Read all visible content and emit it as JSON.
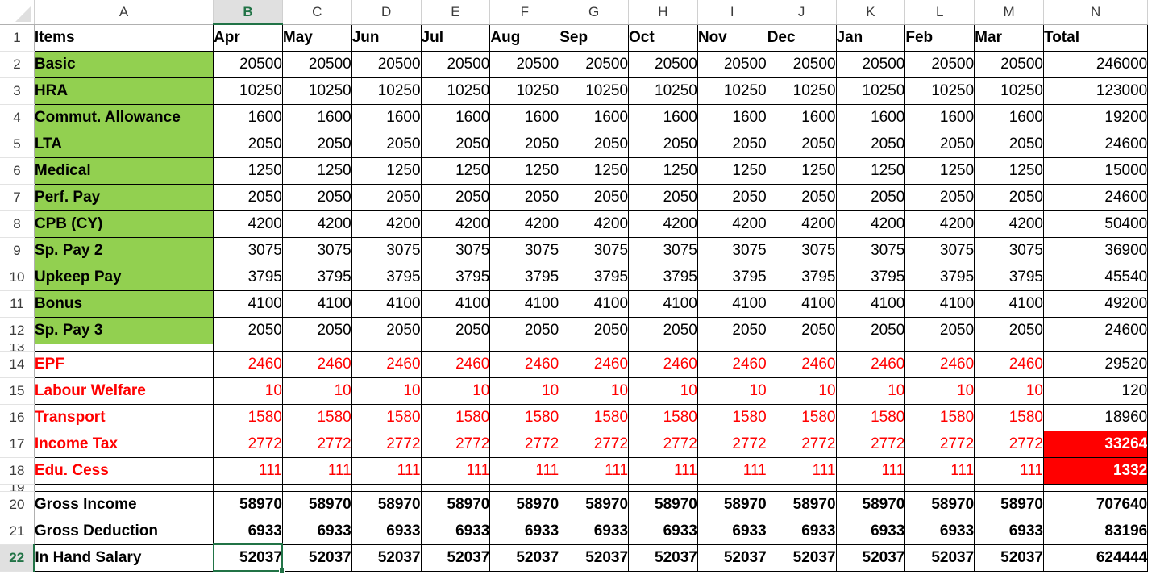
{
  "app": {
    "type": "spreadsheet",
    "select_all_label": "",
    "active_cell": "B22",
    "selected_column": "B",
    "selected_row": "22"
  },
  "colors": {
    "earnings_fill": "#92D050",
    "deduction_text": "#FF0000",
    "highlight_fill": "#FF0000",
    "highlight_text": "#FFFFFF",
    "selection_accent": "#217346"
  },
  "columns": [
    {
      "letter": "A",
      "selected": false
    },
    {
      "letter": "B",
      "selected": true
    },
    {
      "letter": "C",
      "selected": false
    },
    {
      "letter": "D",
      "selected": false
    },
    {
      "letter": "E",
      "selected": false
    },
    {
      "letter": "F",
      "selected": false
    },
    {
      "letter": "G",
      "selected": false
    },
    {
      "letter": "H",
      "selected": false
    },
    {
      "letter": "I",
      "selected": false
    },
    {
      "letter": "J",
      "selected": false
    },
    {
      "letter": "K",
      "selected": false
    },
    {
      "letter": "L",
      "selected": false
    },
    {
      "letter": "M",
      "selected": false
    },
    {
      "letter": "N",
      "selected": false
    }
  ],
  "header_row": {
    "row_number": "1",
    "cells": [
      "Items",
      "Apr",
      "May",
      "Jun",
      "Jul",
      "Aug",
      "Sep",
      "Oct",
      "Nov",
      "Dec",
      "Jan",
      "Feb",
      "Mar",
      "Total"
    ]
  },
  "rows": [
    {
      "row_number": "2",
      "kind": "earning",
      "label": "Basic",
      "values": [
        "20500",
        "20500",
        "20500",
        "20500",
        "20500",
        "20500",
        "20500",
        "20500",
        "20500",
        "20500",
        "20500",
        "20500"
      ],
      "total": "246000"
    },
    {
      "row_number": "3",
      "kind": "earning",
      "label": "HRA",
      "values": [
        "10250",
        "10250",
        "10250",
        "10250",
        "10250",
        "10250",
        "10250",
        "10250",
        "10250",
        "10250",
        "10250",
        "10250"
      ],
      "total": "123000"
    },
    {
      "row_number": "4",
      "kind": "earning",
      "label": "Commut. Allowance",
      "values": [
        "1600",
        "1600",
        "1600",
        "1600",
        "1600",
        "1600",
        "1600",
        "1600",
        "1600",
        "1600",
        "1600",
        "1600"
      ],
      "total": "19200"
    },
    {
      "row_number": "5",
      "kind": "earning",
      "label": "LTA",
      "values": [
        "2050",
        "2050",
        "2050",
        "2050",
        "2050",
        "2050",
        "2050",
        "2050",
        "2050",
        "2050",
        "2050",
        "2050"
      ],
      "total": "24600"
    },
    {
      "row_number": "6",
      "kind": "earning",
      "label": "Medical",
      "values": [
        "1250",
        "1250",
        "1250",
        "1250",
        "1250",
        "1250",
        "1250",
        "1250",
        "1250",
        "1250",
        "1250",
        "1250"
      ],
      "total": "15000"
    },
    {
      "row_number": "7",
      "kind": "earning",
      "label": "Perf. Pay",
      "values": [
        "2050",
        "2050",
        "2050",
        "2050",
        "2050",
        "2050",
        "2050",
        "2050",
        "2050",
        "2050",
        "2050",
        "2050"
      ],
      "total": "24600"
    },
    {
      "row_number": "8",
      "kind": "earning",
      "label": "CPB (CY)",
      "values": [
        "4200",
        "4200",
        "4200",
        "4200",
        "4200",
        "4200",
        "4200",
        "4200",
        "4200",
        "4200",
        "4200",
        "4200"
      ],
      "total": "50400"
    },
    {
      "row_number": "9",
      "kind": "earning",
      "label": "Sp. Pay 2",
      "values": [
        "3075",
        "3075",
        "3075",
        "3075",
        "3075",
        "3075",
        "3075",
        "3075",
        "3075",
        "3075",
        "3075",
        "3075"
      ],
      "total": "36900"
    },
    {
      "row_number": "10",
      "kind": "earning",
      "label": "Upkeep Pay",
      "values": [
        "3795",
        "3795",
        "3795",
        "3795",
        "3795",
        "3795",
        "3795",
        "3795",
        "3795",
        "3795",
        "3795",
        "3795"
      ],
      "total": "45540"
    },
    {
      "row_number": "11",
      "kind": "earning",
      "label": "Bonus",
      "values": [
        "4100",
        "4100",
        "4100",
        "4100",
        "4100",
        "4100",
        "4100",
        "4100",
        "4100",
        "4100",
        "4100",
        "4100"
      ],
      "total": "49200"
    },
    {
      "row_number": "12",
      "kind": "earning",
      "label": "Sp. Pay 3",
      "values": [
        "2050",
        "2050",
        "2050",
        "2050",
        "2050",
        "2050",
        "2050",
        "2050",
        "2050",
        "2050",
        "2050",
        "2050"
      ],
      "total": "24600"
    },
    {
      "row_number": "13",
      "kind": "spacer",
      "label": "",
      "values": [
        "",
        "",
        "",
        "",
        "",
        "",
        "",
        "",
        "",
        "",
        "",
        ""
      ],
      "total": ""
    },
    {
      "row_number": "14",
      "kind": "deduction",
      "label": "EPF",
      "values": [
        "2460",
        "2460",
        "2460",
        "2460",
        "2460",
        "2460",
        "2460",
        "2460",
        "2460",
        "2460",
        "2460",
        "2460"
      ],
      "total": "29520"
    },
    {
      "row_number": "15",
      "kind": "deduction",
      "label": "Labour Welfare",
      "values": [
        "10",
        "10",
        "10",
        "10",
        "10",
        "10",
        "10",
        "10",
        "10",
        "10",
        "10",
        "10"
      ],
      "total": "120"
    },
    {
      "row_number": "16",
      "kind": "deduction",
      "label": "Transport",
      "values": [
        "1580",
        "1580",
        "1580",
        "1580",
        "1580",
        "1580",
        "1580",
        "1580",
        "1580",
        "1580",
        "1580",
        "1580"
      ],
      "total": "18960"
    },
    {
      "row_number": "17",
      "kind": "deduction",
      "label": "Income Tax",
      "values": [
        "2772",
        "2772",
        "2772",
        "2772",
        "2772",
        "2772",
        "2772",
        "2772",
        "2772",
        "2772",
        "2772",
        "2772"
      ],
      "total": "33264",
      "total_highlight": true
    },
    {
      "row_number": "18",
      "kind": "deduction",
      "label": "Edu. Cess",
      "values": [
        "111",
        "111",
        "111",
        "111",
        "111",
        "111",
        "111",
        "111",
        "111",
        "111",
        "111",
        "111"
      ],
      "total": "1332",
      "total_highlight": true
    },
    {
      "row_number": "19",
      "kind": "spacer",
      "label": "",
      "values": [
        "",
        "",
        "",
        "",
        "",
        "",
        "",
        "",
        "",
        "",
        "",
        ""
      ],
      "total": ""
    },
    {
      "row_number": "20",
      "kind": "summary",
      "label": "Gross Income",
      "values": [
        "58970",
        "58970",
        "58970",
        "58970",
        "58970",
        "58970",
        "58970",
        "58970",
        "58970",
        "58970",
        "58970",
        "58970"
      ],
      "total": "707640"
    },
    {
      "row_number": "21",
      "kind": "summary",
      "label": "Gross Deduction",
      "values": [
        "6933",
        "6933",
        "6933",
        "6933",
        "6933",
        "6933",
        "6933",
        "6933",
        "6933",
        "6933",
        "6933",
        "6933"
      ],
      "total": "83196"
    },
    {
      "row_number": "22",
      "kind": "summary",
      "label": "In Hand Salary",
      "values": [
        "52037",
        "52037",
        "52037",
        "52037",
        "52037",
        "52037",
        "52037",
        "52037",
        "52037",
        "52037",
        "52037",
        "52037"
      ],
      "total": "624444"
    }
  ]
}
